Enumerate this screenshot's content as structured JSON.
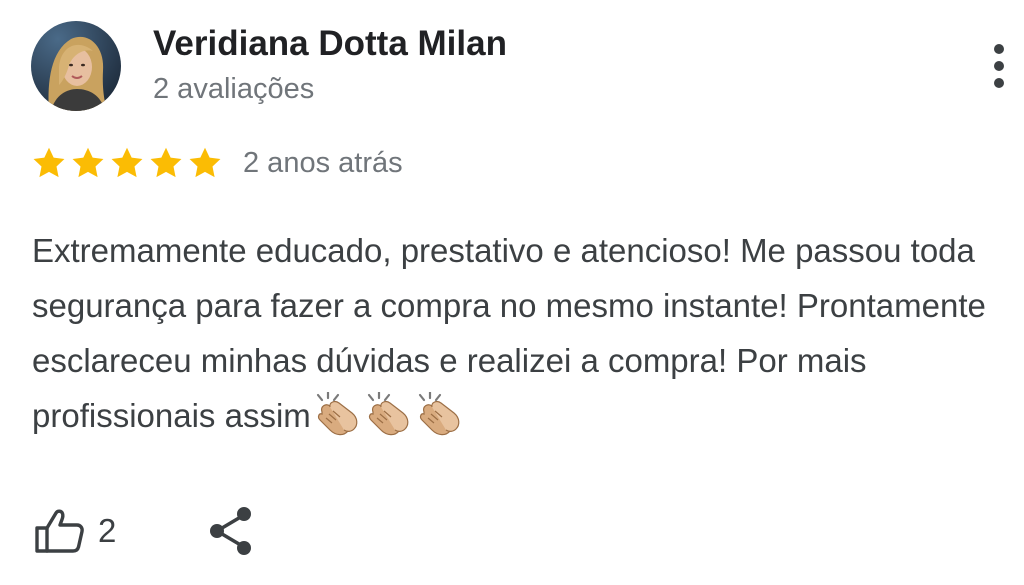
{
  "reviewer": {
    "name": "Veridiana Dotta Milan",
    "review_count": "2 avaliações"
  },
  "rating": {
    "stars": 5,
    "max_stars": 5,
    "date": "2 anos atrás",
    "star_color": "#fbbc04"
  },
  "review": {
    "text": "Extremamente educado, prestativo e atencioso! Me passou toda segurança para fazer a compra no mesmo instante! Prontamente esclareceu minhas dúvidas e realizei a compra! Por mais profissionais assim",
    "emoji": [
      "clapping-hands",
      "clapping-hands",
      "clapping-hands"
    ]
  },
  "actions": {
    "like_count": "2",
    "like_icon": "thumbs-up-outline",
    "share_icon": "share",
    "more_icon": "more-vertical"
  },
  "colors": {
    "name_text": "#202124",
    "secondary_text": "#70757a",
    "body_text": "#3c4043"
  }
}
